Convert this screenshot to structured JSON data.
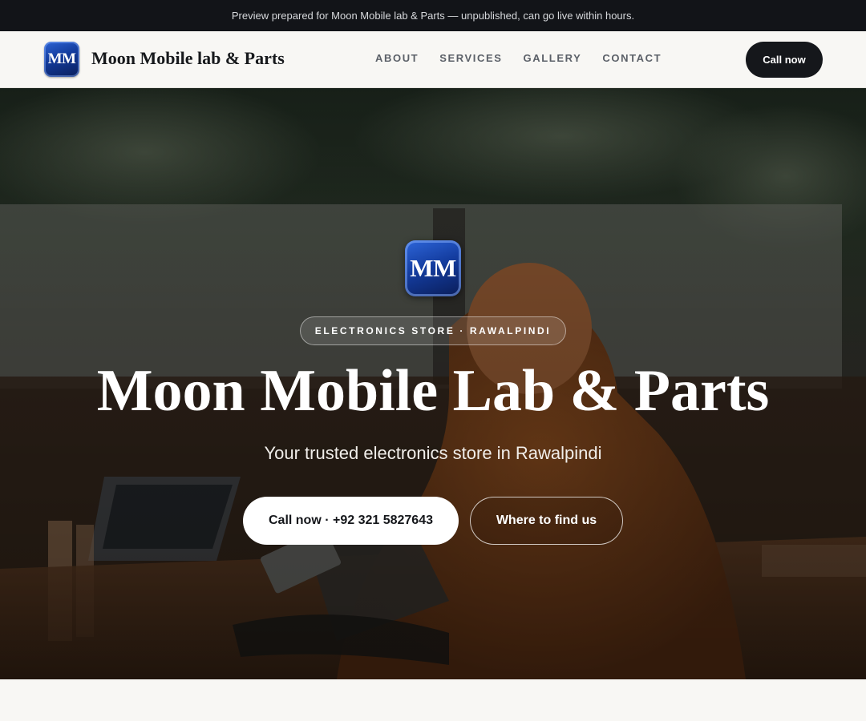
{
  "announcement": {
    "text": "Preview prepared for Moon Mobile lab & Parts — unpublished, can go live within hours."
  },
  "header": {
    "logo_text": "MM",
    "brand_name": "Moon Mobile lab & Parts",
    "nav": [
      {
        "label": "ABOUT"
      },
      {
        "label": "SERVICES"
      },
      {
        "label": "GALLERY"
      },
      {
        "label": "CONTACT"
      }
    ],
    "cta_label": "Call now"
  },
  "hero": {
    "logo_text": "MM",
    "badge": "ELECTRONICS STORE · RAWALPINDI",
    "title": "Moon Mobile Lab & Parts",
    "subtitle": "Your trusted electronics store in Rawalpindi",
    "primary_button": "Call now · +92 321 5827643",
    "secondary_button": "Where to find us"
  },
  "colors": {
    "topbar_bg": "#121418",
    "page_bg": "#f8f7f4",
    "dark_button": "#15171b",
    "logo_blue": "#143da0",
    "nav_text": "#5b6068"
  },
  "icons": {
    "brand_logo": "mm-monogram-logo"
  }
}
